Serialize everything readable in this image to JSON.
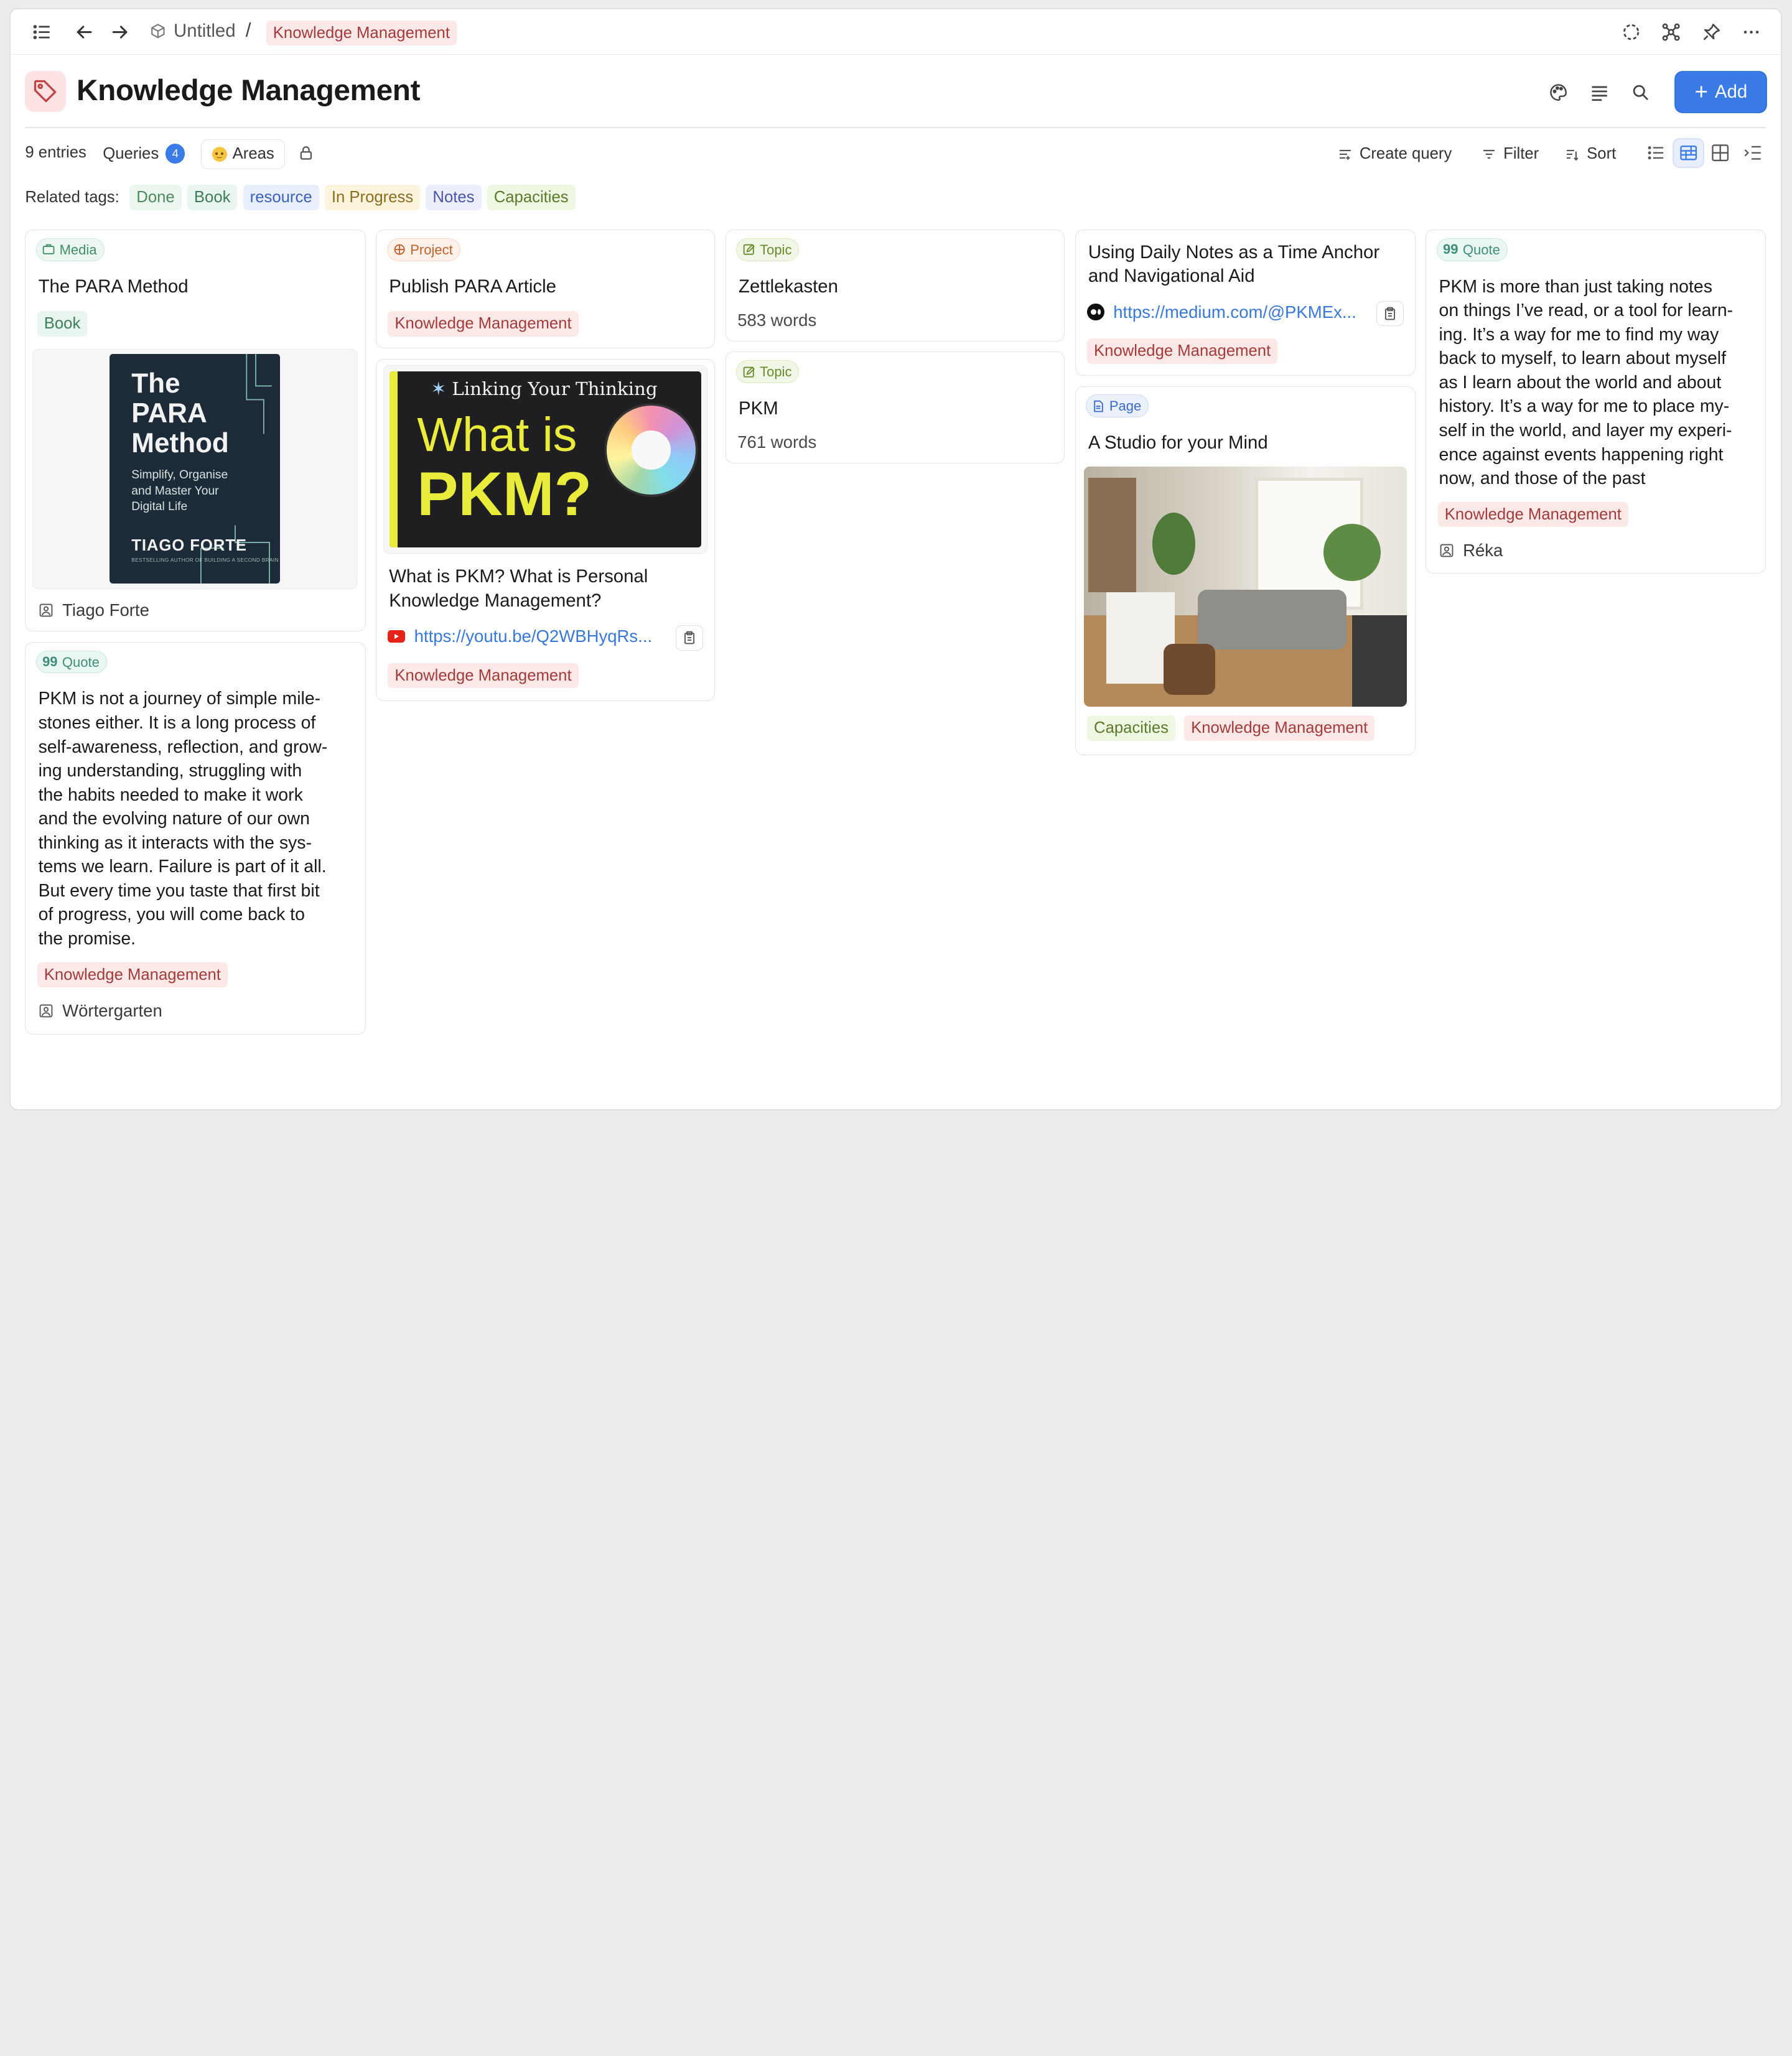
{
  "breadcrumb": {
    "root": "Untitled",
    "separator": "/",
    "current": "Knowledge Management"
  },
  "page": {
    "title": "Knowledge Management",
    "add_label": "Add"
  },
  "toolbar": {
    "entries": "9 entries",
    "queries_label": "Queries",
    "queries_count": "4",
    "areas_label": "Areas",
    "create_query": "Create query",
    "filter": "Filter",
    "sort": "Sort"
  },
  "related": {
    "label": "Related tags:",
    "tags": [
      {
        "label": "Done",
        "color": "#4d8a5f",
        "bg": "#ebf6ee"
      },
      {
        "label": "Book",
        "color": "#3d7d58",
        "bg": "#e9f6ef"
      },
      {
        "label": "resource",
        "color": "#3a63b8",
        "bg": "#e8eefb"
      },
      {
        "label": "In Progress",
        "color": "#8a6d1e",
        "bg": "#fbf3dc"
      },
      {
        "label": "Notes",
        "color": "#4a55a8",
        "bg": "#eceefb"
      },
      {
        "label": "Capacities",
        "color": "#5b7a2a",
        "bg": "#eef7e2"
      }
    ]
  },
  "cards": {
    "para": {
      "type": "Media",
      "title": "The PARA Method",
      "tag": "Book",
      "cover": {
        "line1": "The",
        "line2": "PARA",
        "line3": "Method",
        "sub1": "Simplify, Organise",
        "sub2": "and Master Your",
        "sub3": "Digital Life",
        "author": "TIAGO FORTE",
        "byline": "BESTSELLING AUTHOR OF BUILDING A SECOND BRAIN"
      },
      "person": "Tiago Forte"
    },
    "quote1": {
      "type": "Quote",
      "lines": [
        "PKM is not a journey of simple mile-",
        "stones either. It is a long process of",
        "self-awareness, reflection, and grow-",
        "ing understanding, struggling with",
        "the habits needed to make it work",
        "and the evolving nature of our own",
        "thinking as it interacts with the sys-",
        "tems we learn. Failure is part of it all.",
        "But every time you taste that first bit",
        "of progress, you will come back to",
        "the promise."
      ],
      "tag": "Knowledge Management",
      "person": "Wörtergarten"
    },
    "project": {
      "type": "Project",
      "title": "Publish PARA Article",
      "tag": "Knowledge Management"
    },
    "pkm_video": {
      "thumb": {
        "brand": "Linking Your Thinking",
        "line1": "What is",
        "line2": "PKM?"
      },
      "title_l1": "What is PKM? What is Personal",
      "title_l2": "Knowledge Management?",
      "url": "https://youtu.be/Q2WBHyqRs...",
      "tag": "Knowledge Management"
    },
    "zettel": {
      "type": "Topic",
      "title": "Zettlekasten",
      "meta": "583 words"
    },
    "pkm": {
      "type": "Topic",
      "title": "PKM",
      "meta": "761 words"
    },
    "daily": {
      "title_l1": "Using Daily Notes as a Time Anchor",
      "title_l2": "and Navigational Aid",
      "url": "https://medium.com/@PKMEx...",
      "tag": "Knowledge Management"
    },
    "studio": {
      "type": "Page",
      "title": "A Studio for your Mind",
      "tags": [
        "Capacities",
        "Knowledge Management"
      ]
    },
    "quote2": {
      "type": "Quote",
      "lines": [
        "PKM is more than just taking notes",
        "on things I’ve read, or a tool for learn-",
        "ing. It’s a way for me to find my way",
        "back to myself, to learn about myself",
        "as I learn about the world and about",
        "history. It’s a way for me to place my-",
        "self in the world, and layer my experi-",
        "ence against events happening right",
        "now, and those of the past"
      ],
      "tag": "Knowledge Management",
      "person": "Réka"
    }
  }
}
